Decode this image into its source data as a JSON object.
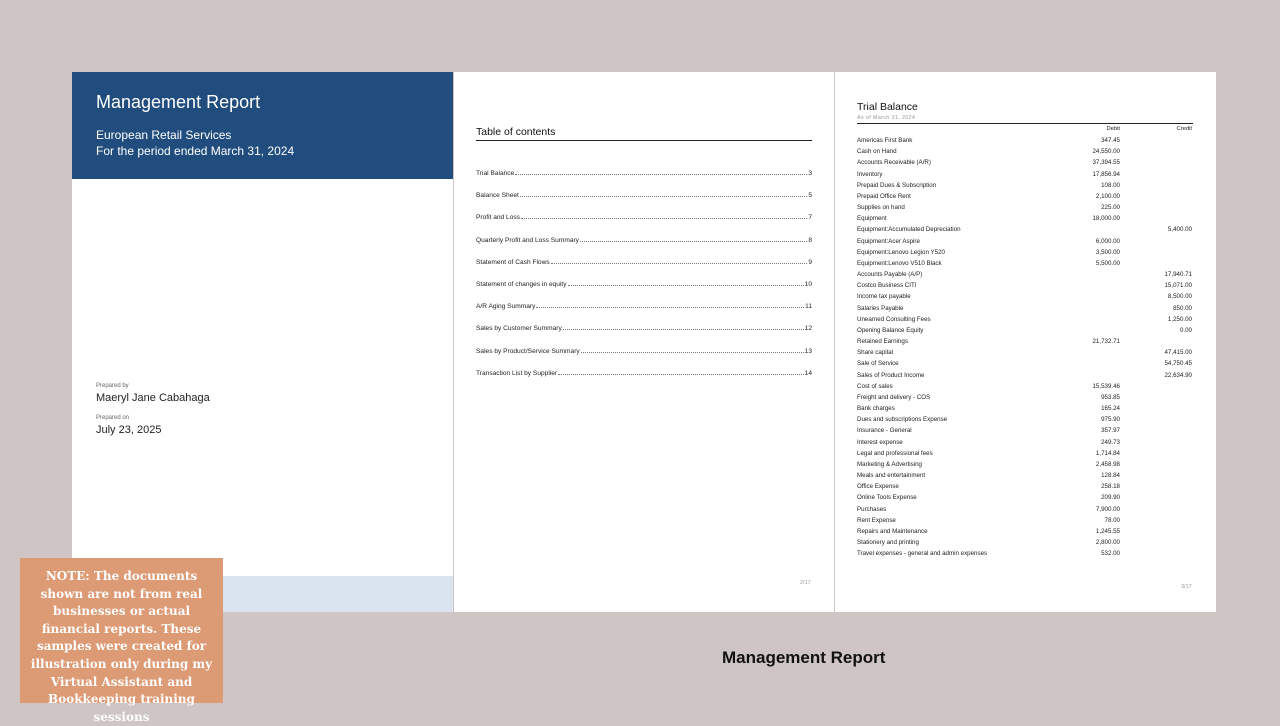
{
  "cover": {
    "title": "Management Report",
    "company": "European Retail Services",
    "period": "For the period ended March 31, 2024",
    "prepared_by_label": "Prepared by",
    "prepared_by": "Maeryl Jane Cabahaga",
    "prepared_on_label": "Prepared on",
    "prepared_on": "July 23, 2025"
  },
  "toc": {
    "title": "Table of contents",
    "entries": [
      {
        "label": "Trial Balance",
        "page": "3"
      },
      {
        "label": "Balance Sheet",
        "page": "5"
      },
      {
        "label": "Profit and Loss",
        "page": "7"
      },
      {
        "label": "Quarterly Profit and Loss Summary",
        "page": "8"
      },
      {
        "label": "Statement of Cash Flows",
        "page": "9"
      },
      {
        "label": "Statement of changes in equity",
        "page": "10"
      },
      {
        "label": "A/R Aging Summary",
        "page": "11"
      },
      {
        "label": "Sales by Customer Summary",
        "page": "12"
      },
      {
        "label": "Sales by Product/Service Summary",
        "page": "13"
      },
      {
        "label": "Transaction List by Supplier",
        "page": "14"
      }
    ],
    "page_number": "2/17"
  },
  "trial_balance": {
    "title": "Trial Balance",
    "subtitle": "As of March 31, 2024",
    "debit_header": "Debit",
    "credit_header": "Credit",
    "rows": [
      {
        "account": "Americas First Bank",
        "debit": "347.45",
        "credit": ""
      },
      {
        "account": "Cash on Hand",
        "debit": "24,550.00",
        "credit": ""
      },
      {
        "account": "Accounts Receivable (A/R)",
        "debit": "37,394.55",
        "credit": ""
      },
      {
        "account": "Inventory",
        "debit": "17,856.94",
        "credit": ""
      },
      {
        "account": "Prepaid Dues & Subscription",
        "debit": "108.00",
        "credit": ""
      },
      {
        "account": "Prepaid Office Rent",
        "debit": "2,100.00",
        "credit": ""
      },
      {
        "account": "Supplies on hand",
        "debit": "225.00",
        "credit": ""
      },
      {
        "account": "Equipment",
        "debit": "18,000.00",
        "credit": ""
      },
      {
        "account": "Equipment:Accumulated Depreciation",
        "debit": "",
        "credit": "5,400.00"
      },
      {
        "account": "Equipment:Acer Aspire",
        "debit": "6,000.00",
        "credit": ""
      },
      {
        "account": "Equipment:Lenovo Legion Y520",
        "debit": "3,500.00",
        "credit": ""
      },
      {
        "account": "Equipment:Lenovo V510 Black",
        "debit": "5,500.00",
        "credit": ""
      },
      {
        "account": "Accounts Payable (A/P)",
        "debit": "",
        "credit": "17,940.71"
      },
      {
        "account": "Costco Business CITI",
        "debit": "",
        "credit": "15,071.00"
      },
      {
        "account": "Income tax payable",
        "debit": "",
        "credit": "8,500.00"
      },
      {
        "account": "Salaries Payable",
        "debit": "",
        "credit": "850.00"
      },
      {
        "account": "Unearned Consulting Fees",
        "debit": "",
        "credit": "1,250.00"
      },
      {
        "account": "Opening Balance Equity",
        "debit": "",
        "credit": "0.00"
      },
      {
        "account": "Retained Earnings",
        "debit": "21,732.71",
        "credit": ""
      },
      {
        "account": "Share capital",
        "debit": "",
        "credit": "47,415.00"
      },
      {
        "account": "Sale of Service",
        "debit": "",
        "credit": "54,750.45"
      },
      {
        "account": "Sales of Product Income",
        "debit": "",
        "credit": "22,634.90"
      },
      {
        "account": "Cost of sales",
        "debit": "15,539.46",
        "credit": ""
      },
      {
        "account": "Freight and delivery - COS",
        "debit": "953.85",
        "credit": ""
      },
      {
        "account": "Bank charges",
        "debit": "165.24",
        "credit": ""
      },
      {
        "account": "Dues and subscriptions Expense",
        "debit": "975.90",
        "credit": ""
      },
      {
        "account": "Insurance - General",
        "debit": "357.97",
        "credit": ""
      },
      {
        "account": "Interest expense",
        "debit": "249.73",
        "credit": ""
      },
      {
        "account": "Legal and professional fees",
        "debit": "1,714.84",
        "credit": ""
      },
      {
        "account": "Marketing & Advertising",
        "debit": "2,458.98",
        "credit": ""
      },
      {
        "account": "Meals and entertainment",
        "debit": "128.84",
        "credit": ""
      },
      {
        "account": "Office Expense",
        "debit": "258.18",
        "credit": ""
      },
      {
        "account": "Online Tools Expense",
        "debit": "209.90",
        "credit": ""
      },
      {
        "account": "Purchases",
        "debit": "7,900.00",
        "credit": ""
      },
      {
        "account": "Rent Expense",
        "debit": "78.00",
        "credit": ""
      },
      {
        "account": "Repairs and Maintenance",
        "debit": "1,245.55",
        "credit": ""
      },
      {
        "account": "Stationery and printing",
        "debit": "2,800.00",
        "credit": ""
      },
      {
        "account": "Travel expenses - general and admin expenses",
        "debit": "532.00",
        "credit": ""
      }
    ],
    "page_number": "3/17"
  },
  "note": "NOTE: The documents shown are not from real businesses or actual financial reports. These samples were created for illustration only during my Virtual Assistant and Bookkeeping training sessions",
  "caption": "Management Report",
  "colors": {
    "background": "#cfc5c4",
    "cover_header": "#214d7e",
    "cover_footer": "#dae4ef",
    "note_box": "#dc9a75"
  }
}
